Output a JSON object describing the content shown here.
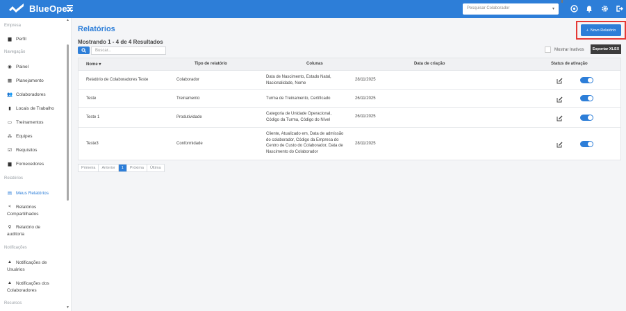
{
  "app": {
    "name": "BlueOpex"
  },
  "topbar": {
    "collab_select_placeholder": "Pesquisar Colaborador",
    "icons": [
      "help-icon",
      "bell-icon",
      "gear-icon",
      "logout-icon"
    ]
  },
  "sidebar": {
    "sections": {
      "empresa": "Empresa",
      "navegacao": "Navegação",
      "relatorios": "Relatórios",
      "notificacoes": "Notificações",
      "recursos": "Recursos"
    },
    "items": {
      "perfil": "Perfil",
      "painel": "Painel",
      "planejamento": "Planejamento",
      "colaboradores": "Colaboradores",
      "locais": "Locais de Trabalho",
      "treinamentos": "Treinamentos",
      "equipes": "Equipes",
      "requisitos": "Requisitos",
      "fornecedores": "Fornecedores",
      "meus_relatorios": "Meus Relatórios",
      "relatorios_compartilhados_1": "Relatórios",
      "relatorios_compartilhados_2": "Compartilhados",
      "relatorio_auditoria_1": "Relatório de",
      "relatorio_auditoria_2": "auditoria",
      "notif_usuarios_1": "Notificações de",
      "notif_usuarios_2": "Usuários",
      "notif_colaboradores_1": "Notificações dos",
      "notif_colaboradores_2": "Colaboradores"
    }
  },
  "main": {
    "title": "Relatórios",
    "new_button": "Novo Relatório",
    "results_text": "Mostrando 1 - 4 de 4 Resultados",
    "search_placeholder": "Buscar...",
    "show_inactive": "Mostrar Inativos",
    "export_button": "Exportar XLSX",
    "columns": {
      "nome": "Nome",
      "tipo": "Tipo de relatório",
      "colunas": "Colunas",
      "data": "Data de criação",
      "status": "Status de ativação"
    },
    "rows": [
      {
        "nome": "Relatório de Colaboradores Teste",
        "tipo": "Colaborador",
        "colunas": [
          "Data de Nascimento, Estado Natal,",
          "Nacionalidade, Nome"
        ],
        "data": "28/11/2025",
        "active": true
      },
      {
        "nome": "Teste",
        "tipo": "Treinamento",
        "colunas": [
          "Turma de Treinamento, Certificado"
        ],
        "data": "26/11/2025",
        "active": true
      },
      {
        "nome": "Teste 1",
        "tipo": "Produtividade",
        "colunas": [
          "Categoria de Unidade Operacional,",
          "Código da Turma, Código do Nível"
        ],
        "data": "26/11/2025",
        "active": true
      },
      {
        "nome": "Teste3",
        "tipo": "Conformidade",
        "colunas": [
          "Cliente, Atualizado em, Data de admissão",
          "do colaborador, Código da Empresa do",
          "Centro de Custo do Colaborador, Data de",
          "Nascimento do Colaborador"
        ],
        "data": "28/11/2025",
        "active": true
      }
    ],
    "pagination": {
      "first": "Primeira",
      "prev": "Anterior",
      "current": "1",
      "next": "Próxima",
      "last": "Última"
    }
  },
  "colors": {
    "primary": "#2d7ed8",
    "highlight": "#e53935",
    "dark_button": "#3c3c3c"
  }
}
